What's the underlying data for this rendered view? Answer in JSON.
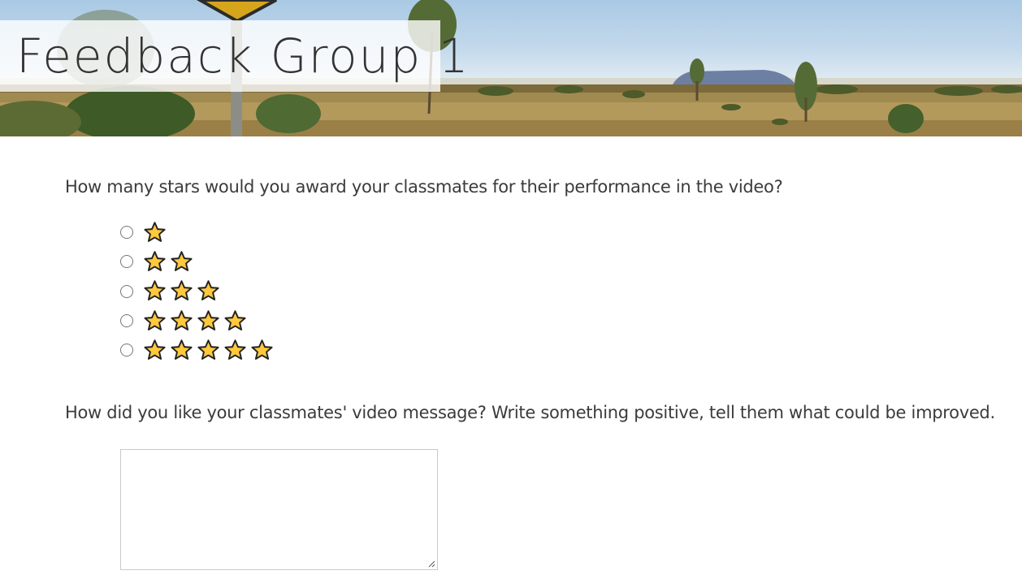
{
  "header": {
    "title": "Feedback Group 1"
  },
  "rating_question": {
    "prompt": "How many stars would you award your classmates for their performance in the video?",
    "options": [
      {
        "stars": 1,
        "selected": false
      },
      {
        "stars": 2,
        "selected": false
      },
      {
        "stars": 3,
        "selected": false
      },
      {
        "stars": 4,
        "selected": false
      },
      {
        "stars": 5,
        "selected": false
      }
    ],
    "star_icon": "star-icon",
    "star_fill": "#ffc83d",
    "star_outline": "#222222"
  },
  "comment_question": {
    "prompt": "How did you like your classmates' video message? Write something positive, tell them what could be improved.",
    "value": ""
  }
}
